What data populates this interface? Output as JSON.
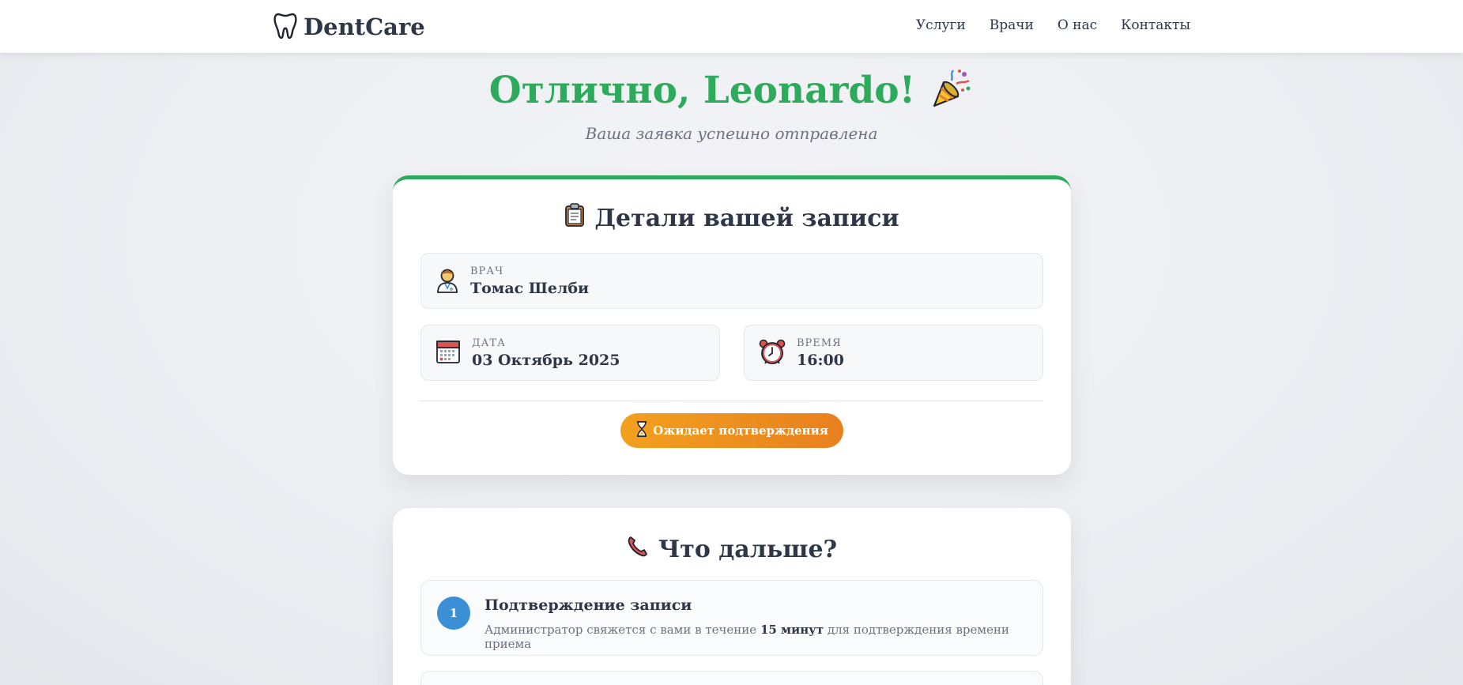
{
  "header": {
    "brand": "DentCare",
    "nav": [
      "Услуги",
      "Врачи",
      "О нас",
      "Контакты"
    ]
  },
  "hero": {
    "title": "Отлично, Leonardo!",
    "subtitle": "Ваша заявка успешно отправлена"
  },
  "details": {
    "title": "Детали вашей записи",
    "doctor": {
      "label": "ВРАЧ",
      "value": "Томас Шелби"
    },
    "date": {
      "label": "ДАТА",
      "value": "03 Октябрь 2025"
    },
    "time": {
      "label": "ВРЕМЯ",
      "value": "16:00"
    },
    "status": "Ожидает подтверждения"
  },
  "next": {
    "title": "Что дальше?",
    "steps": [
      {
        "number": "1",
        "title": "Подтверждение записи",
        "desc_before": "Администратор свяжется с вами в течение ",
        "desc_bold": "15 минут",
        "desc_after": " для подтверждения времени приема"
      }
    ]
  },
  "colors": {
    "accent_green": "#2eaa5c",
    "status_orange": "#f2a01e",
    "step_blue": "#3b8fd4",
    "text_dark": "#2d3748"
  },
  "icons": {
    "brand": "tooth-icon",
    "hero": "party-popper-icon",
    "details": "clipboard-icon",
    "doctor": "doctor-icon",
    "date": "calendar-icon",
    "time": "alarm-clock-icon",
    "status": "hourglass-icon",
    "next": "phone-icon"
  }
}
